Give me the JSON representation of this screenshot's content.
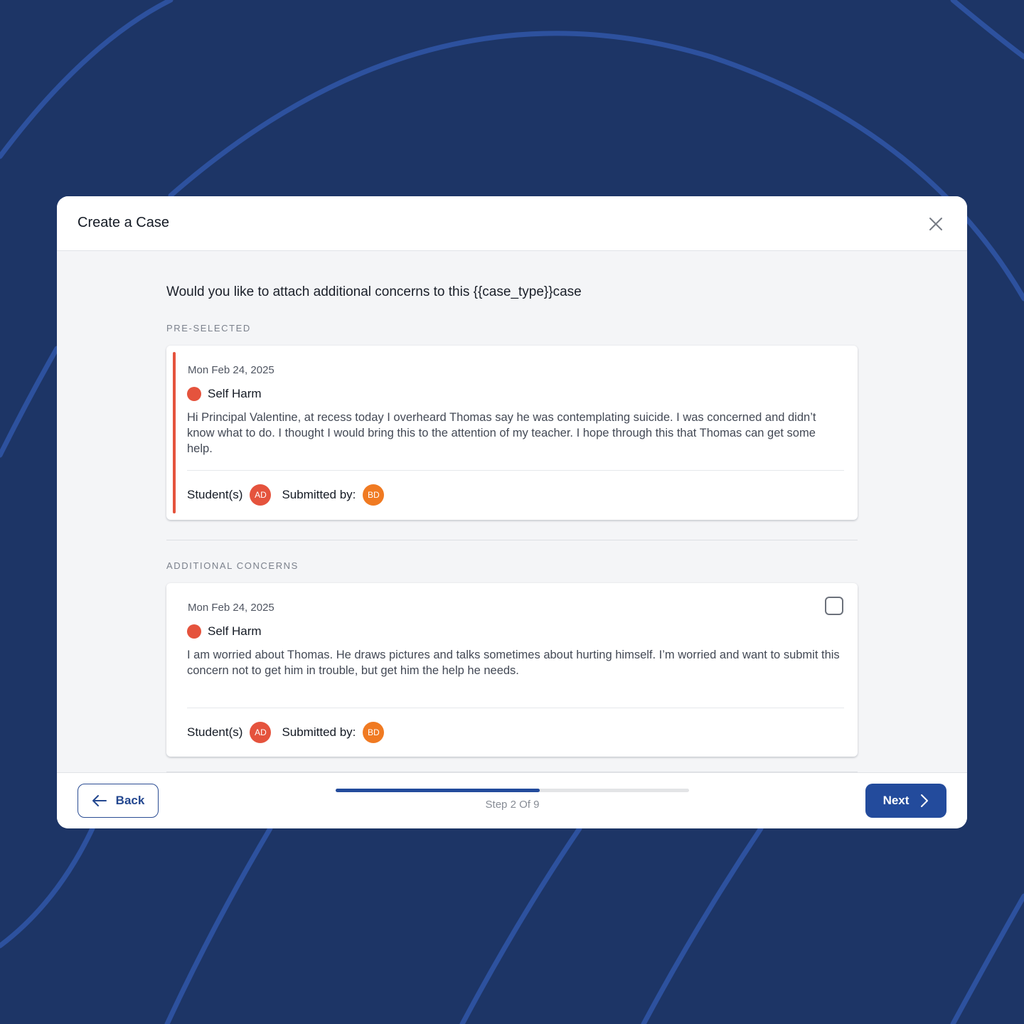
{
  "modal": {
    "title": "Create a Case",
    "close_icon": "close-icon"
  },
  "question": "Would you like to attach additional concerns to this {{case_type}}case",
  "preselected": {
    "label": "PRE-SELECTED",
    "card": {
      "date": "Mon Feb 24, 2025",
      "type": "Self Harm",
      "type_color": "#e5533d",
      "text": "Hi Principal Valentine, at recess today I overheard Thomas say he was contemplating suicide. I was concerned and didn’t know what to do. I thought I would bring this to the attention of my teacher. I hope through this that Thomas can get some help.",
      "students_label": "Student(s)",
      "student_initials": "AD",
      "submitted_label": "Submitted by:",
      "submitter_initials": "BD"
    }
  },
  "additional": {
    "label": "ADDITIONAL CONCERNS",
    "cards": [
      {
        "date": "Mon Feb 24, 2025",
        "type": "Self Harm",
        "type_color": "#e5533d",
        "text": "I am worried about Thomas. He draws pictures and talks sometimes about hurting himself. I’m worried and want to submit this concern not to get him in trouble, but get him the help he needs.",
        "students_label": "Student(s)",
        "student_initials": "AD",
        "submitted_label": "Submitted by:",
        "submitter_initials": "BD",
        "checked": false
      }
    ]
  },
  "footer": {
    "back_label": "Back",
    "next_label": "Next",
    "step_label": "Step 2 Of 9",
    "step_current": 2,
    "step_total": 9,
    "progress_fraction": 0.577
  },
  "colors": {
    "background": "#1d3566",
    "accent": "#234b9c",
    "danger": "#e5533d",
    "submitter_avatar": "#f07a22"
  }
}
